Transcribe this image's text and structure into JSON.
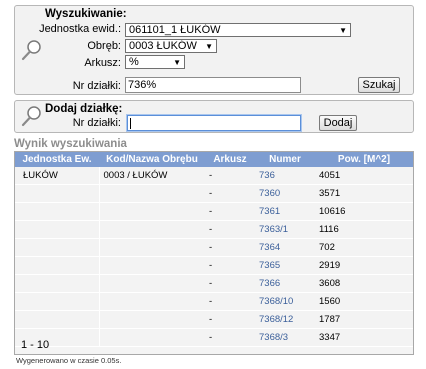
{
  "search": {
    "title": "Wyszukiwanie:",
    "jednostka_label": "Jednostka ewid.:",
    "jednostka_value": "061101_1 ŁUKÓW",
    "obreb_label": "Obręb:",
    "obreb_value": "0003 ŁUKÓW",
    "arkusz_label": "Arkusz:",
    "arkusz_value": "%",
    "nr_label": "Nr działki:",
    "nr_value": "736%",
    "button": "Szukaj"
  },
  "add": {
    "title": "Dodaj działkę:",
    "nr_label": "Nr działki:",
    "nr_value": "",
    "button": "Dodaj"
  },
  "results": {
    "title": "Wynik wyszukiwania",
    "headers": [
      "Jednostka Ew.",
      "Kod/Nazwa Obrębu",
      "Arkusz",
      "Numer",
      "Pow. [M^2]"
    ],
    "rows": [
      [
        "ŁUKÓW",
        "0003 / ŁUKÓW",
        "-",
        "736",
        "4051"
      ],
      [
        "",
        "",
        "-",
        "7360",
        "3571"
      ],
      [
        "",
        "",
        "-",
        "7361",
        "10616"
      ],
      [
        "",
        "",
        "-",
        "7363/1",
        "1116"
      ],
      [
        "",
        "",
        "-",
        "7364",
        "702"
      ],
      [
        "",
        "",
        "-",
        "7365",
        "2919"
      ],
      [
        "",
        "",
        "-",
        "7366",
        "3608"
      ],
      [
        "",
        "",
        "-",
        "7368/10",
        "1560"
      ],
      [
        "",
        "",
        "-",
        "7368/12",
        "1787"
      ],
      [
        "",
        "",
        "-",
        "7368/3",
        "3347"
      ]
    ],
    "pager": "1 - 10"
  },
  "footer": {
    "generated": "Wygenerowano w czasie 0.05s."
  },
  "colors": {
    "header_bg": "#7e9dd1",
    "link": "#3b5f9a",
    "panel_bg": "#f2f2f2"
  }
}
